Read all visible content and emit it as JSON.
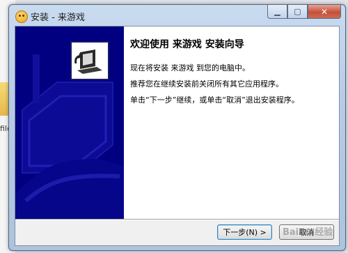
{
  "desktop": {
    "partial_label": "file"
  },
  "window": {
    "title": "安装 - 来游戏",
    "controls": {
      "minimize": "▁",
      "maximize": "▢",
      "close": "✕"
    }
  },
  "wizard": {
    "headline": "欢迎使用 来游戏 安装向导",
    "lines": [
      "现在将安装 来游戏 到您的电脑中。",
      "推荐您在继续安装前关闭所有其它应用程序。",
      "单击“下一步”继续，或单击“取消”退出安装程序。"
    ]
  },
  "buttons": {
    "next": "下一步(N) >",
    "cancel": "取消"
  },
  "watermark": "Baidu 经验",
  "colors": {
    "banner": "#000080",
    "accent": "#3c7fb1"
  }
}
